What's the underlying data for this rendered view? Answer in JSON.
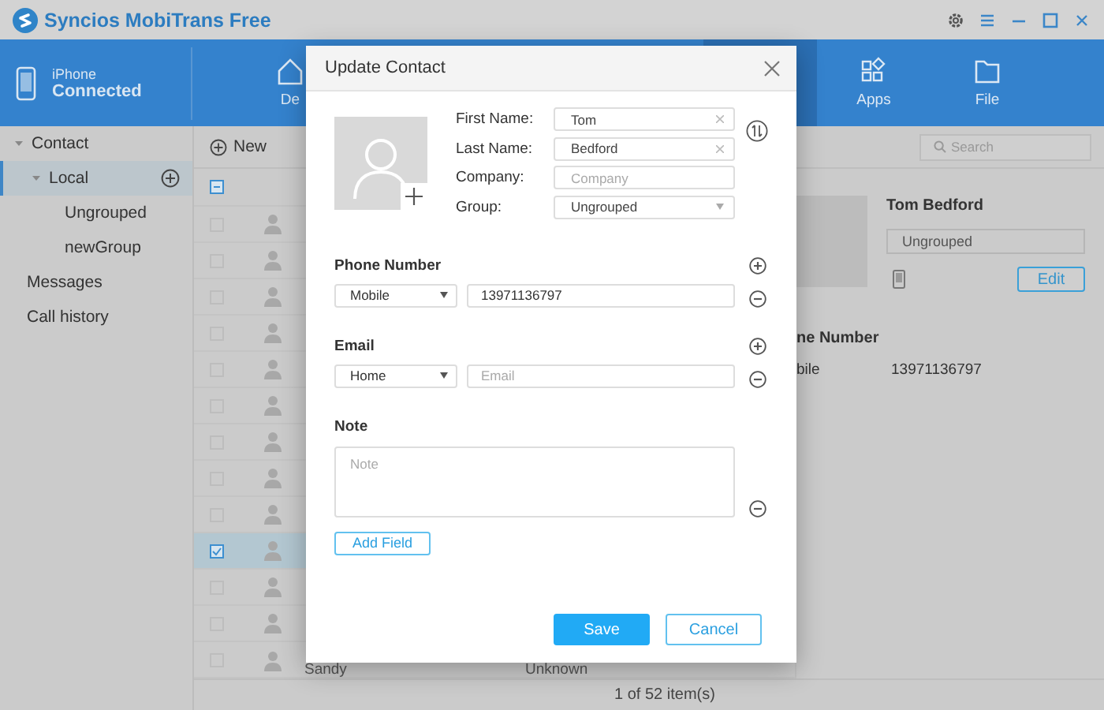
{
  "window": {
    "title": "Syncios MobiTrans Free"
  },
  "device": {
    "name": "iPhone",
    "status": "Connected"
  },
  "nav_tabs": [
    {
      "label": "De",
      "selected": false
    },
    {
      "selected": true
    },
    {
      "label": "Apps",
      "selected": false
    },
    {
      "label": "File",
      "selected": false
    }
  ],
  "sidebar": {
    "items": [
      {
        "label": "Contact",
        "expanded": true,
        "selected": false,
        "children": [
          {
            "label": "Local",
            "expanded": true,
            "selected": true,
            "children": [
              {
                "label": "Ungrouped",
                "selected": false
              },
              {
                "label": "newGroup",
                "selected": false
              }
            ]
          }
        ]
      },
      {
        "label": "Messages",
        "selected": false
      },
      {
        "label": "Call history",
        "selected": false
      }
    ]
  },
  "toolbar": {
    "new_button": "New",
    "search": {
      "placeholder": "Search"
    }
  },
  "table": {
    "header_partial": true,
    "rows": [
      {
        "checked": false
      },
      {
        "checked": false
      },
      {
        "checked": false
      },
      {
        "checked": false
      },
      {
        "checked": false
      },
      {
        "checked": false
      },
      {
        "checked": false
      },
      {
        "checked": false
      },
      {
        "checked": false
      },
      {
        "checked": true
      },
      {
        "checked": false
      },
      {
        "checked": false
      },
      {
        "checked": false,
        "name": "Sandy",
        "phone": "Unknown"
      }
    ]
  },
  "detail": {
    "name": "Tom Bedford",
    "group": "Ungrouped",
    "edit_button": "Edit",
    "phone_heading": "ne Number",
    "phones": [
      {
        "type": "bile",
        "number": "13971136797"
      }
    ]
  },
  "status_bar": {
    "text": "1 of 52 item(s)"
  },
  "dialog": {
    "title": "Update Contact",
    "fields": [
      {
        "label": "First Name:",
        "value": "Tom",
        "kind": "text"
      },
      {
        "label": "Last Name:",
        "value": "Bedford",
        "kind": "text"
      },
      {
        "label": "Company:",
        "placeholder": "Company",
        "kind": "text"
      },
      {
        "label": "Group:",
        "value": "Ungrouped",
        "kind": "select"
      }
    ],
    "sections": [
      {
        "heading": "Phone Number",
        "kind": "entry",
        "type": "Mobile",
        "value": "13971136797"
      },
      {
        "heading": "Email",
        "kind": "entry",
        "type": "Home",
        "placeholder": "Email"
      },
      {
        "heading": "Note",
        "kind": "note",
        "placeholder": "Note"
      }
    ],
    "add_field": "Add Field",
    "buttons": [
      {
        "label": "Save",
        "primary": true
      },
      {
        "label": "Cancel",
        "primary": false
      }
    ]
  }
}
